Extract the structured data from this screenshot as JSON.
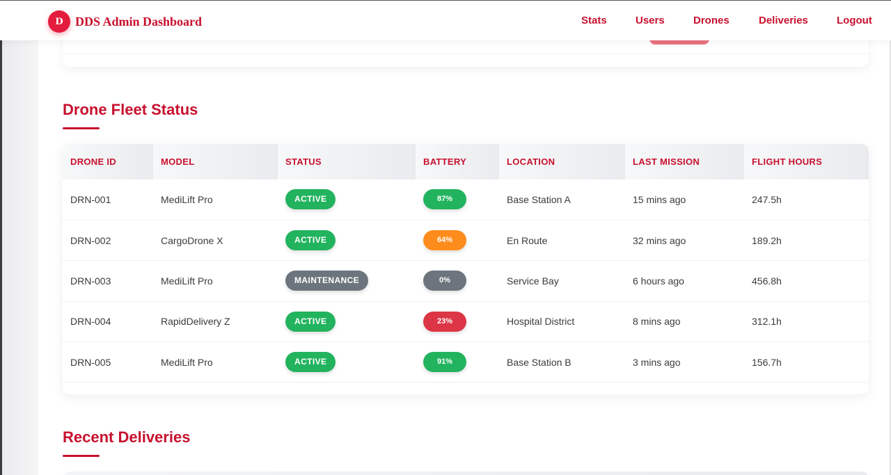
{
  "brand": {
    "logo_letter": "D",
    "name": "DDS Admin Dashboard"
  },
  "nav": [
    {
      "label": "Stats"
    },
    {
      "label": "Users"
    },
    {
      "label": "Drones"
    },
    {
      "label": "Deliveries"
    },
    {
      "label": "Logout"
    }
  ],
  "fleet": {
    "title": "Drone Fleet Status",
    "columns": [
      "DRONE ID",
      "MODEL",
      "STATUS",
      "BATTERY",
      "LOCATION",
      "LAST MISSION",
      "FLIGHT HOURS"
    ],
    "rows": [
      {
        "id": "DRN-001",
        "model": "MediLift Pro",
        "status": "ACTIVE",
        "battery": "87%",
        "location": "Base Station A",
        "last_mission": "15 mins ago",
        "hours": "247.5h"
      },
      {
        "id": "DRN-002",
        "model": "CargoDrone X",
        "status": "ACTIVE",
        "battery": "64%",
        "location": "En Route",
        "last_mission": "32 mins ago",
        "hours": "189.2h"
      },
      {
        "id": "DRN-003",
        "model": "MediLift Pro",
        "status": "MAINTENANCE",
        "battery": "0%",
        "location": "Service Bay",
        "last_mission": "6 hours ago",
        "hours": "456.8h"
      },
      {
        "id": "DRN-004",
        "model": "RapidDelivery Z",
        "status": "ACTIVE",
        "battery": "23%",
        "location": "Hospital District",
        "last_mission": "8 mins ago",
        "hours": "312.1h"
      },
      {
        "id": "DRN-005",
        "model": "MediLift Pro",
        "status": "ACTIVE",
        "battery": "91%",
        "location": "Base Station B",
        "last_mission": "3 mins ago",
        "hours": "156.7h"
      }
    ]
  },
  "deliveries": {
    "title": "Recent Deliveries"
  },
  "colors": {
    "accent": "#c8102e",
    "active": "#22b35e",
    "maintenance": "#6c757d",
    "battery_high": "#22b35e",
    "battery_mid": "#fd8c1c",
    "battery_low": "#dc3545",
    "battery_empty": "#6c757d"
  }
}
